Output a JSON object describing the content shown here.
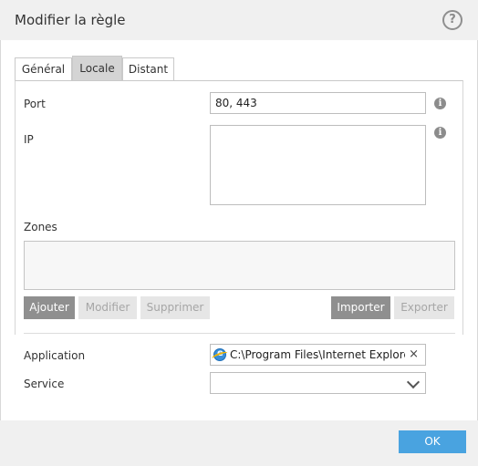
{
  "dialog": {
    "title": "Modifier la règle",
    "help_symbol": "?"
  },
  "tabs": [
    {
      "label": "Général",
      "active": false
    },
    {
      "label": "Locale",
      "active": true
    },
    {
      "label": "Distant",
      "active": false
    }
  ],
  "fields": {
    "port_label": "Port",
    "port_value": "80, 443",
    "ip_label": "IP",
    "ip_value": "",
    "zones_label": "Zones",
    "application_label": "Application",
    "application_value": "C:\\Program Files\\Internet Explorer\\iexplore.exe",
    "service_label": "Service",
    "service_value": ""
  },
  "zone_buttons": {
    "add": "Ajouter",
    "edit": "Modifier",
    "delete": "Supprimer",
    "import": "Importer",
    "export": "Exporter"
  },
  "icons": {
    "info": "i",
    "clear": "×"
  },
  "footer": {
    "ok_label": "OK"
  },
  "colors": {
    "accent": "#49a3e0",
    "button_dark": "#8f8f8f",
    "button_disabled": "#e6e6e6",
    "header_bg": "#f0f0f0"
  }
}
